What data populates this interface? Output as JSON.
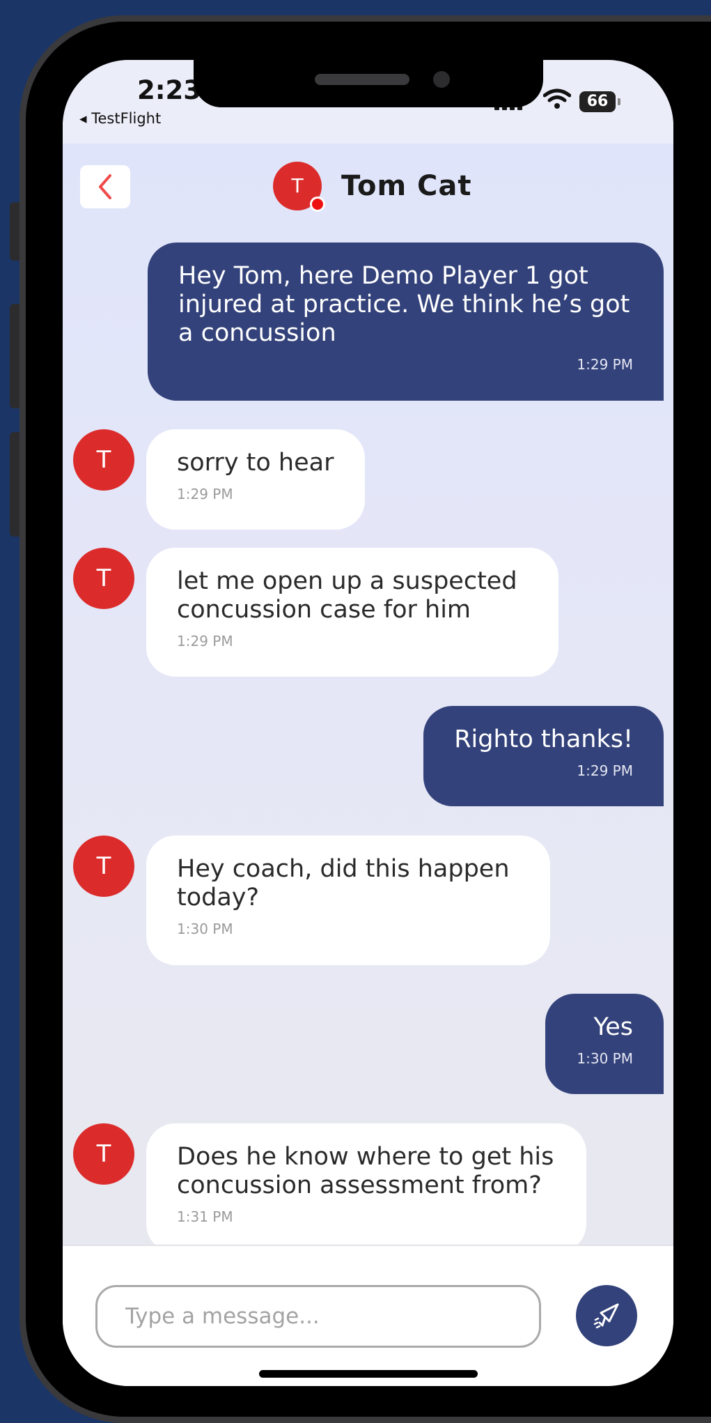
{
  "status_bar": {
    "time": "2:23",
    "back_app_label": "◂ TestFlight",
    "battery_level": "66"
  },
  "header": {
    "contact_name": "Tom Cat",
    "avatar_initial": "T",
    "online": true,
    "back_icon": "chevron-left-icon",
    "accent_color": "#f04b4b"
  },
  "messages": [
    {
      "direction": "outgoing",
      "text": "Hey Tom, here Demo Player 1 got injured at practice. We think he’s got a concussion",
      "time": "1:29 PM"
    },
    {
      "direction": "incoming",
      "avatar_initial": "T",
      "text": "sorry to hear",
      "time": "1:29 PM"
    },
    {
      "direction": "incoming",
      "avatar_initial": "T",
      "text": "let me open up a suspected concussion case for him",
      "time": "1:29 PM"
    },
    {
      "direction": "outgoing",
      "text": "Righto thanks!",
      "time": "1:29 PM"
    },
    {
      "direction": "incoming",
      "avatar_initial": "T",
      "text": "Hey coach, did this happen today?",
      "time": "1:30 PM"
    },
    {
      "direction": "outgoing",
      "text": "Yes",
      "time": "1:30 PM"
    },
    {
      "direction": "incoming",
      "avatar_initial": "T",
      "text": "Does he know where to get his concussion assessment from?",
      "time": "1:31 PM"
    }
  ],
  "composer": {
    "placeholder": "Type a message...",
    "value": "",
    "send_icon": "send-paper-plane-icon"
  },
  "colors": {
    "outgoing_bubble": "#33427a",
    "incoming_bubble": "#ffffff",
    "avatar": "#dc2b2b",
    "send_button": "#33427a",
    "background": "#1b3566"
  }
}
